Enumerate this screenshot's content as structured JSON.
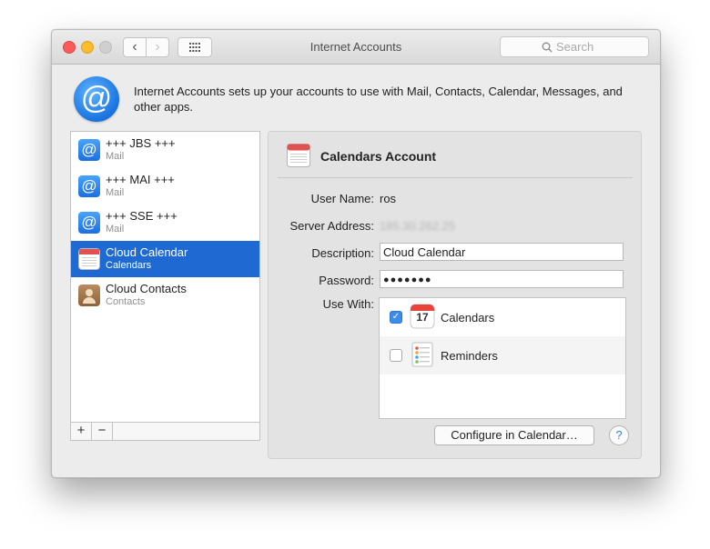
{
  "window": {
    "title": "Internet Accounts",
    "search_placeholder": "Search"
  },
  "header": {
    "description": "Internet Accounts sets up your accounts to use with Mail, Contacts, Calendar, Messages, and other apps."
  },
  "accounts": [
    {
      "name": "+++ JBS +++",
      "type": "Mail",
      "icon": "at-icon",
      "selected": false
    },
    {
      "name": "+++ MAI +++",
      "type": "Mail",
      "icon": "at-icon",
      "selected": false
    },
    {
      "name": "+++ SSE +++",
      "type": "Mail",
      "icon": "at-icon",
      "selected": false
    },
    {
      "name": "Cloud Calendar",
      "type": "Calendars",
      "icon": "calendar-icon",
      "selected": true
    },
    {
      "name": "Cloud Contacts",
      "type": "Contacts",
      "icon": "contacts-icon",
      "selected": false
    }
  ],
  "list_buttons": {
    "add": "+",
    "remove": "−"
  },
  "detail": {
    "title": "Calendars Account",
    "user_name_label": "User Name:",
    "user_name": "ros",
    "server_address_label": "Server Address:",
    "server_address": "185.30.262.25",
    "description_label": "Description:",
    "description": "Cloud Calendar",
    "password_label": "Password:",
    "password": "●●●●●●●",
    "use_with_label": "Use With:",
    "use_with": [
      {
        "label": "Calendars",
        "checked": true,
        "icon": "calendar-app-icon",
        "icon_day": "17"
      },
      {
        "label": "Reminders",
        "checked": false,
        "icon": "reminders-app-icon"
      }
    ],
    "configure_button": "Configure in Calendar…",
    "help_button": "?"
  },
  "colors": {
    "selection": "#1e69d2",
    "checkbox_checked": "#3b8ded",
    "close": "#fc5b57",
    "minimize": "#fdbc2e"
  }
}
